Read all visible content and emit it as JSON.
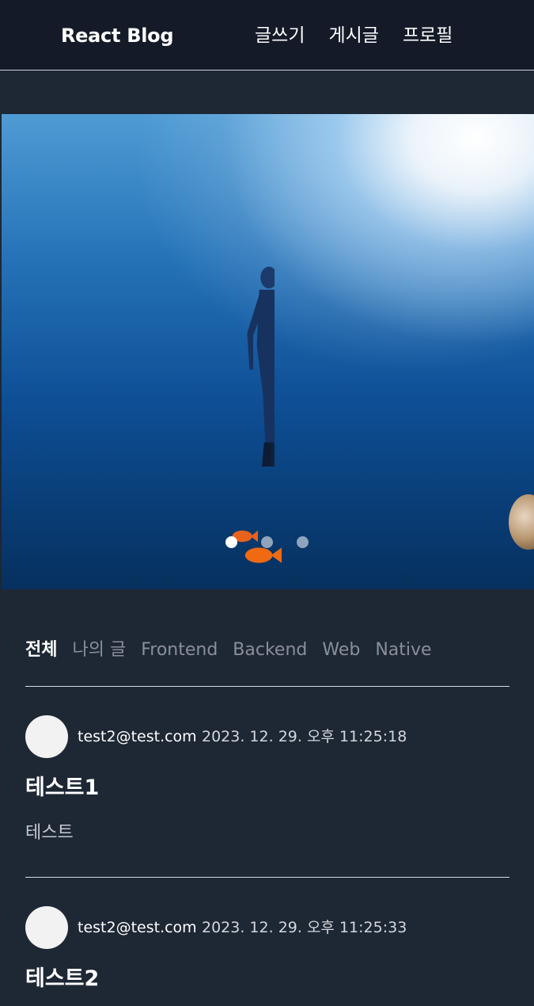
{
  "header": {
    "logo": "React Blog",
    "nav": [
      "글쓰기",
      "게시글",
      "프로필"
    ]
  },
  "carousel": {
    "slide_count": 3,
    "active_index": 0,
    "image_description_name": "freediver-underwater"
  },
  "tabs": {
    "items": [
      "전체",
      "나의 글",
      "Frontend",
      "Backend",
      "Web",
      "Native"
    ],
    "active_index": 0
  },
  "posts": [
    {
      "author": "test2@test.com",
      "date": "2023. 12. 29. 오후 11:25:18",
      "title": "테스트1",
      "body": "테스트"
    },
    {
      "author": "test2@test.com",
      "date": "2023. 12. 29. 오후 11:25:33",
      "title": "테스트2",
      "body": ""
    }
  ],
  "colors": {
    "background": "#1e2734",
    "header": "#141a28",
    "text": "#ffffff",
    "muted_tab": "#8a8f99",
    "avatar": "#f2f2f2"
  }
}
